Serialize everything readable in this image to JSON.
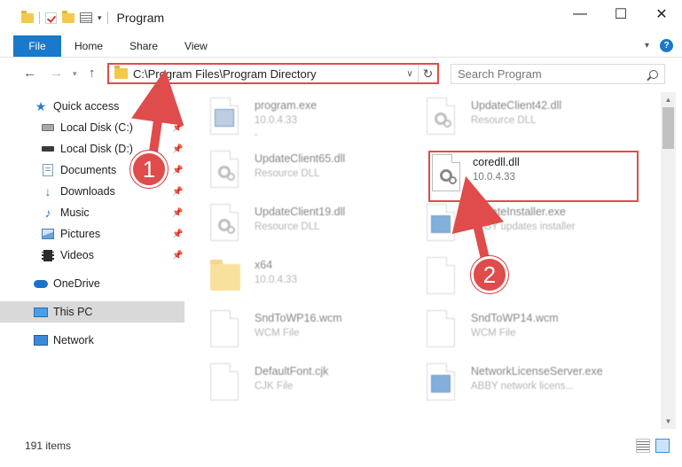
{
  "window": {
    "title": "Program",
    "controls": {
      "minimize": "—",
      "maximize": "☐",
      "close": "✕"
    }
  },
  "ribbon": {
    "file_label": "File",
    "tabs": [
      "Home",
      "Share",
      "View"
    ]
  },
  "address": {
    "path": "C:\\Program Files\\Program Directory",
    "search_placeholder": "Search Program"
  },
  "sidebar": {
    "items": [
      {
        "label": "Quick access",
        "icon": "star-icon"
      },
      {
        "label": "Local Disk (C:)",
        "icon": "drive-icon",
        "pinned": true
      },
      {
        "label": "Local Disk (D:)",
        "icon": "drive-icon",
        "pinned": true
      },
      {
        "label": "Documents",
        "icon": "documents-icon",
        "pinned": true
      },
      {
        "label": "Downloads",
        "icon": "downloads-icon",
        "pinned": true
      },
      {
        "label": "Music",
        "icon": "music-icon",
        "pinned": true
      },
      {
        "label": "Pictures",
        "icon": "pictures-icon",
        "pinned": true
      },
      {
        "label": "Videos",
        "icon": "videos-icon",
        "pinned": true
      },
      {
        "label": "OneDrive",
        "icon": "onedrive-icon"
      },
      {
        "label": "This PC",
        "icon": "pc-icon",
        "selected": true
      },
      {
        "label": "Network",
        "icon": "network-icon"
      }
    ]
  },
  "files": [
    {
      "name": "program.exe",
      "sub": "10.0.4.33",
      "dot": "-",
      "icon": "exe-icon"
    },
    {
      "name": "UpdateClient42.dll",
      "sub": "Resource DLL",
      "dot": "",
      "icon": "dll-icon"
    },
    {
      "name": "UpdateClient65.dll",
      "sub": "Resource DLL",
      "dot": "",
      "icon": "dll-icon"
    },
    {
      "name": "coredll.dll",
      "sub": "10.0.4.33",
      "dot": "-",
      "icon": "dll-icon"
    },
    {
      "name": "UpdateClient19.dll",
      "sub": "Resource DLL",
      "dot": "",
      "icon": "dll-icon"
    },
    {
      "name": "UpdateInstaller.exe",
      "sub": "ABBY updates installer",
      "dot": "",
      "icon": "exe-icon"
    },
    {
      "name": "x64",
      "sub": "10.0.4.33",
      "dot": "",
      "icon": "folder-icon"
    },
    {
      "name": "",
      "sub": "",
      "dot": "",
      "icon": "file-icon"
    },
    {
      "name": "SndToWP16.wcm",
      "sub": "WCM File",
      "dot": "",
      "icon": "file-icon"
    },
    {
      "name": "SndToWP14.wcm",
      "sub": "WCM File",
      "dot": "",
      "icon": "file-icon"
    },
    {
      "name": "DefaultFont.cjk",
      "sub": "CJK File",
      "dot": "",
      "icon": "file-icon"
    },
    {
      "name": "NetworkLicenseServer.exe",
      "sub": "ABBY network licens...",
      "dot": "",
      "icon": "exe-icon"
    }
  ],
  "status": {
    "count": "191 items"
  },
  "callouts": [
    "1",
    "2"
  ],
  "colors": {
    "accent": "#1979ca",
    "highlight": "#e04b4b"
  }
}
